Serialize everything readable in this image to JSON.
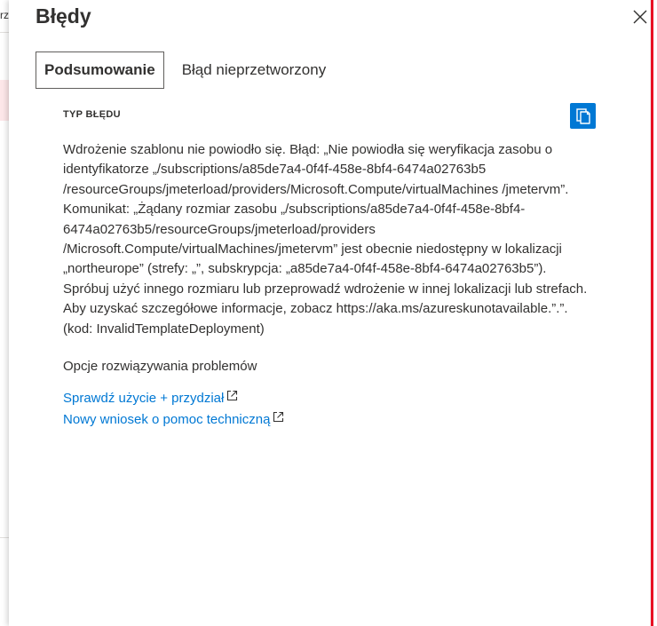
{
  "background": {
    "peek_text": "rz"
  },
  "blade": {
    "title": "Błędy",
    "close_icon": "close-icon"
  },
  "tabs": [
    {
      "label": "Podsumowanie",
      "active": true
    },
    {
      "label": "Błąd nieprzetworzony",
      "active": false
    }
  ],
  "summary": {
    "section_label": "TYP BŁĘDU",
    "copy_icon": "copy-icon",
    "error_message": "Wdrożenie szablonu nie powiodło się. Błąd: „Nie powiodła się weryfikacja zasobu o identyfikatorze „/subscriptions/a85de7a4-0f4f-458e-8bf4-6474a02763b5 /resourceGroups/jmeterload/providers/Microsoft.Compute/virtualMachines /jmetervm”. Komunikat: „Żądany rozmiar zasobu „/subscriptions/a85de7a4-0f4f-458e-8bf4-6474a02763b5/resourceGroups/jmeterload/providers /Microsoft.Compute/virtualMachines/jmetervm” jest obecnie niedostępny w lokalizacji „northeurope” (strefy: „”, subskrypcja: „a85de7a4-0f4f-458e-8bf4-6474a02763b5”). Spróbuj użyć innego rozmiaru lub przeprowadź wdrożenie w innej lokalizacji lub strefach. Aby uzyskać szczegółowe informacje, zobacz https://aka.ms/azureskunotavailable.”.”. (kod: InvalidTemplateDeployment)",
    "troubleshoot_title": "Opcje rozwiązywania problemów",
    "links": [
      {
        "label": "Sprawdź użycie + przydział",
        "icon": "external-link-icon"
      },
      {
        "label": "Nowy wniosek o pomoc techniczną",
        "icon": "external-link-icon"
      }
    ]
  },
  "colors": {
    "accent": "#0078d4",
    "text": "#323130",
    "edge": "#e81123"
  }
}
